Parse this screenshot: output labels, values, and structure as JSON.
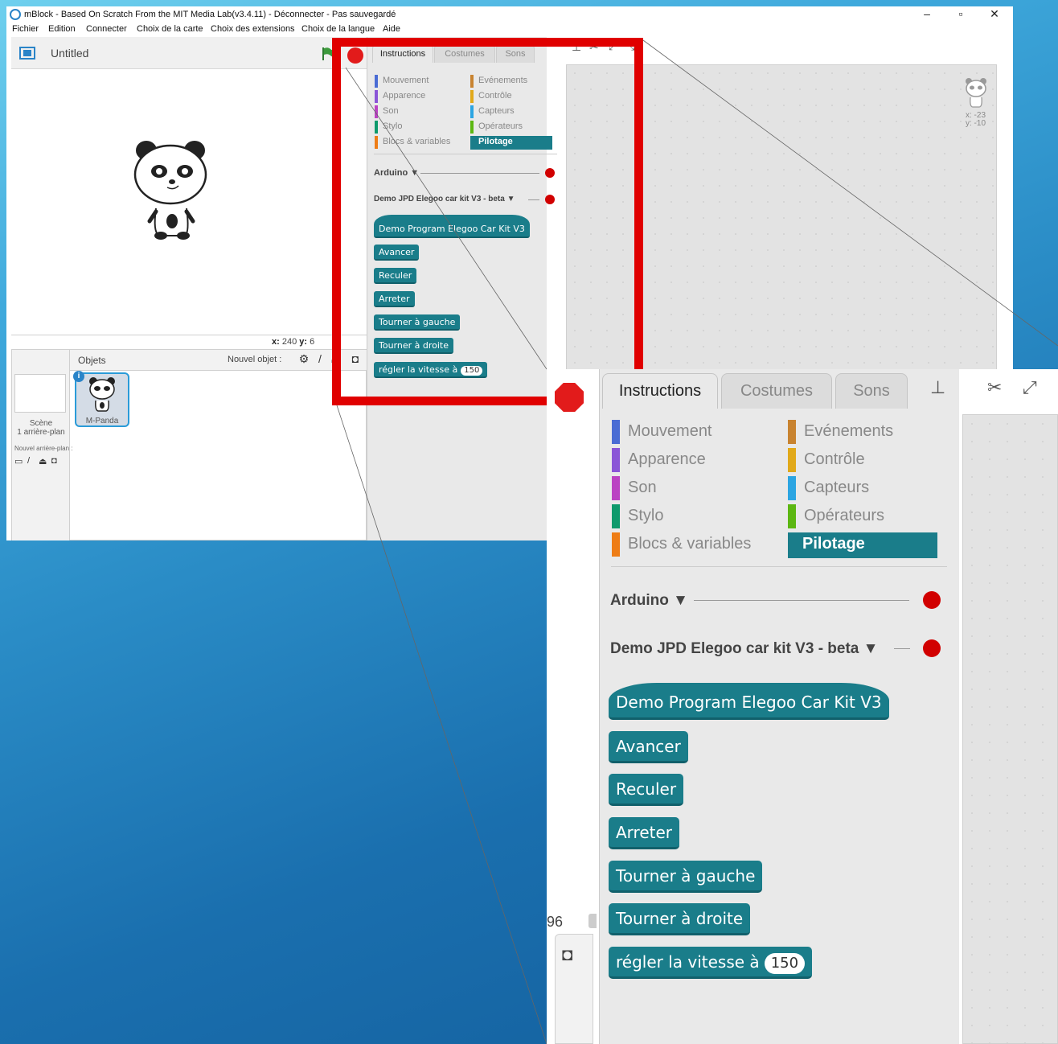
{
  "window": {
    "title": "mBlock - Based On Scratch From the MIT Media Lab(v3.4.11) - Déconnecter - Pas sauvegardé",
    "controls": [
      "–",
      "▫",
      "✕"
    ]
  },
  "menu": [
    "Fichier",
    "Edition",
    "Connecter",
    "Choix de la carte",
    "Choix des extensions",
    "Choix de la langue",
    "Aide"
  ],
  "stage": {
    "project_name": "Untitled",
    "coords": {
      "x_label": "x:",
      "x": "240",
      "y_label": "y:",
      "y": "-96",
      "y_visible": "6"
    }
  },
  "sprites": {
    "header": "Objets",
    "new_object": "Nouvel objet :",
    "scene_label": "Scène",
    "scene_sub": "1 arrière-plan",
    "new_backdrop": "Nouvel arrière-plan :",
    "sprite_name": "M-Panda",
    "info": "i"
  },
  "palette": {
    "tabs": [
      "Instructions",
      "Costumes",
      "Sons"
    ],
    "categories_left": [
      {
        "label": "Mouvement",
        "color": "#4a6cd4"
      },
      {
        "label": "Apparence",
        "color": "#8a55d7"
      },
      {
        "label": "Son",
        "color": "#bb42c3"
      },
      {
        "label": "Stylo",
        "color": "#0e9a6c"
      },
      {
        "label": "Blocs & variables",
        "color": "#ee7d16"
      }
    ],
    "categories_right": [
      {
        "label": "Evénements",
        "color": "#c88330"
      },
      {
        "label": "Contrôle",
        "color": "#e1a91a"
      },
      {
        "label": "Capteurs",
        "color": "#2ca5e2"
      },
      {
        "label": "Opérateurs",
        "color": "#5cb712"
      },
      {
        "label": "Pilotage",
        "color": "#1a7d8a"
      }
    ],
    "extensions": [
      "Arduino ▼",
      "Demo JPD Elegoo car kit V3 - beta ▼"
    ],
    "blocks": [
      "Demo Program Elegoo Car Kit V3",
      "Avancer",
      "Reculer",
      "Arreter",
      "Tourner à gauche",
      "Tourner à droite",
      "régler la vitesse à"
    ],
    "speed_value": "150"
  },
  "script": {
    "x": "x: -23",
    "y": "y: -10"
  },
  "zoom": {
    "coord_fragment": "96"
  },
  "colors": {
    "accent": "#1a7d8a",
    "stop": "#d10000",
    "highlight": "#e00000"
  }
}
